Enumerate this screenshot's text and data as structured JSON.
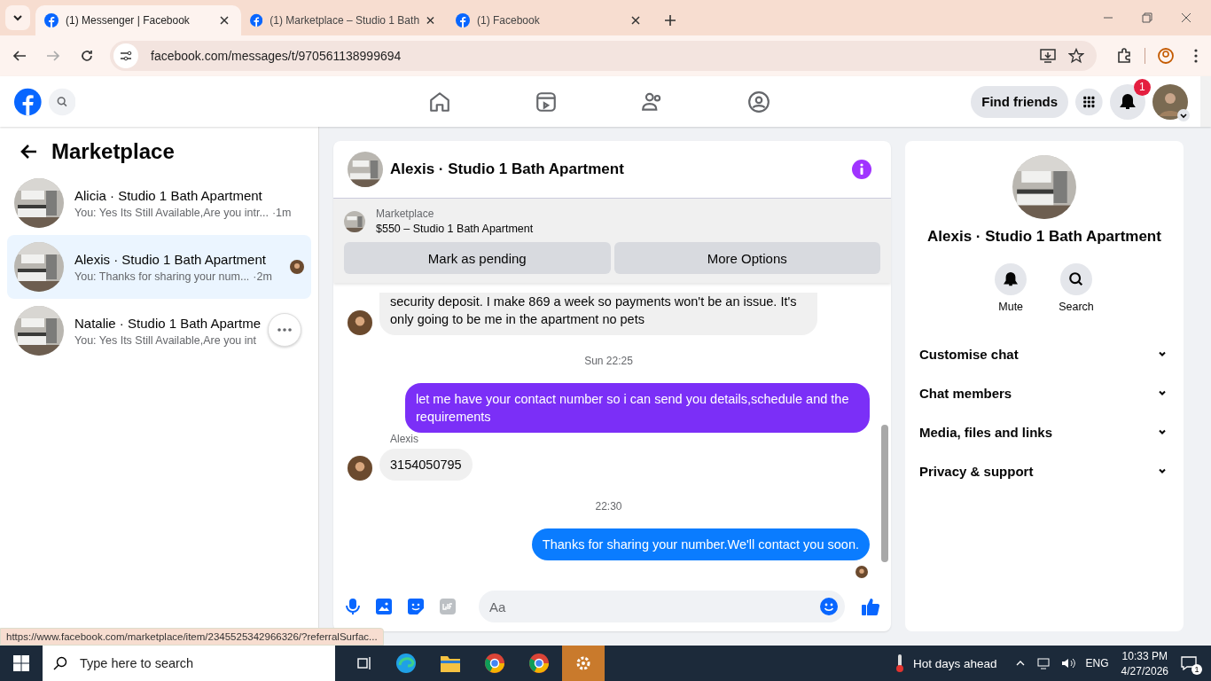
{
  "browser": {
    "tabs": [
      {
        "title": "(1) Messenger | Facebook",
        "selected": true
      },
      {
        "title": "(1) Marketplace – Studio 1 Bath",
        "selected": false
      },
      {
        "title": "(1) Facebook",
        "selected": false
      }
    ],
    "url": "facebook.com/messages/t/970561138999694",
    "status_url": "https://www.facebook.com/marketplace/item/2345525342966326/?referralSurfac..."
  },
  "header": {
    "find_friends": "Find friends",
    "notification_count": "1"
  },
  "sidebar": {
    "title": "Marketplace",
    "conversations": [
      {
        "name": "Alicia · Studio 1 Bath Apartment",
        "preview": "You: Yes Its Still Available,Are you intr...",
        "time": "·1m",
        "selected": false,
        "seen": false
      },
      {
        "name": "Alexis · Studio 1 Bath Apartment",
        "preview": "You: Thanks for sharing your num...",
        "time": "·2m",
        "selected": true,
        "seen": true
      },
      {
        "name": "Natalie · Studio 1 Bath Apartme",
        "preview": "You: Yes Its Still Available,Are you int",
        "selected": false,
        "seen": false
      }
    ]
  },
  "chat": {
    "title": "Alexis · Studio 1 Bath Apartment",
    "listing": {
      "label": "Marketplace",
      "title": "$550 – Studio 1 Bath Apartment"
    },
    "buttons": [
      "Mark as pending",
      "More Options"
    ],
    "messages": [
      {
        "kind": "incoming",
        "text": "security deposit. I make 869 a week so payments won't be an issue. It's only going to be me in the apartment no pets"
      },
      {
        "kind": "timestamp",
        "text": "Sun 22:25"
      },
      {
        "kind": "outgoing",
        "text": "let me have your contact number so i can send you details,schedule and the requirements",
        "color": "#7b2ff7"
      },
      {
        "kind": "sender",
        "text": "Alexis"
      },
      {
        "kind": "incoming",
        "text": "3154050795"
      },
      {
        "kind": "timestamp",
        "text": "22:30"
      },
      {
        "kind": "outgoing",
        "text": "Thanks for sharing your number.We'll contact you soon.",
        "color": "#0a7cff"
      }
    ],
    "composer": {
      "placeholder": "Aa"
    }
  },
  "info": {
    "name": "Alexis · Studio 1 Bath Apartment",
    "actions": [
      {
        "kind": "mute",
        "label": "Mute"
      },
      {
        "kind": "search",
        "label": "Search"
      }
    ],
    "sections": [
      "Customise chat",
      "Chat members",
      "Media, files and links",
      "Privacy & support"
    ]
  },
  "taskbar": {
    "search_placeholder": "Type here to search",
    "weather": "Hot days ahead",
    "language": "ENG",
    "time": "10:33 PM",
    "date": "4/27/2026",
    "notification_count": "1"
  }
}
